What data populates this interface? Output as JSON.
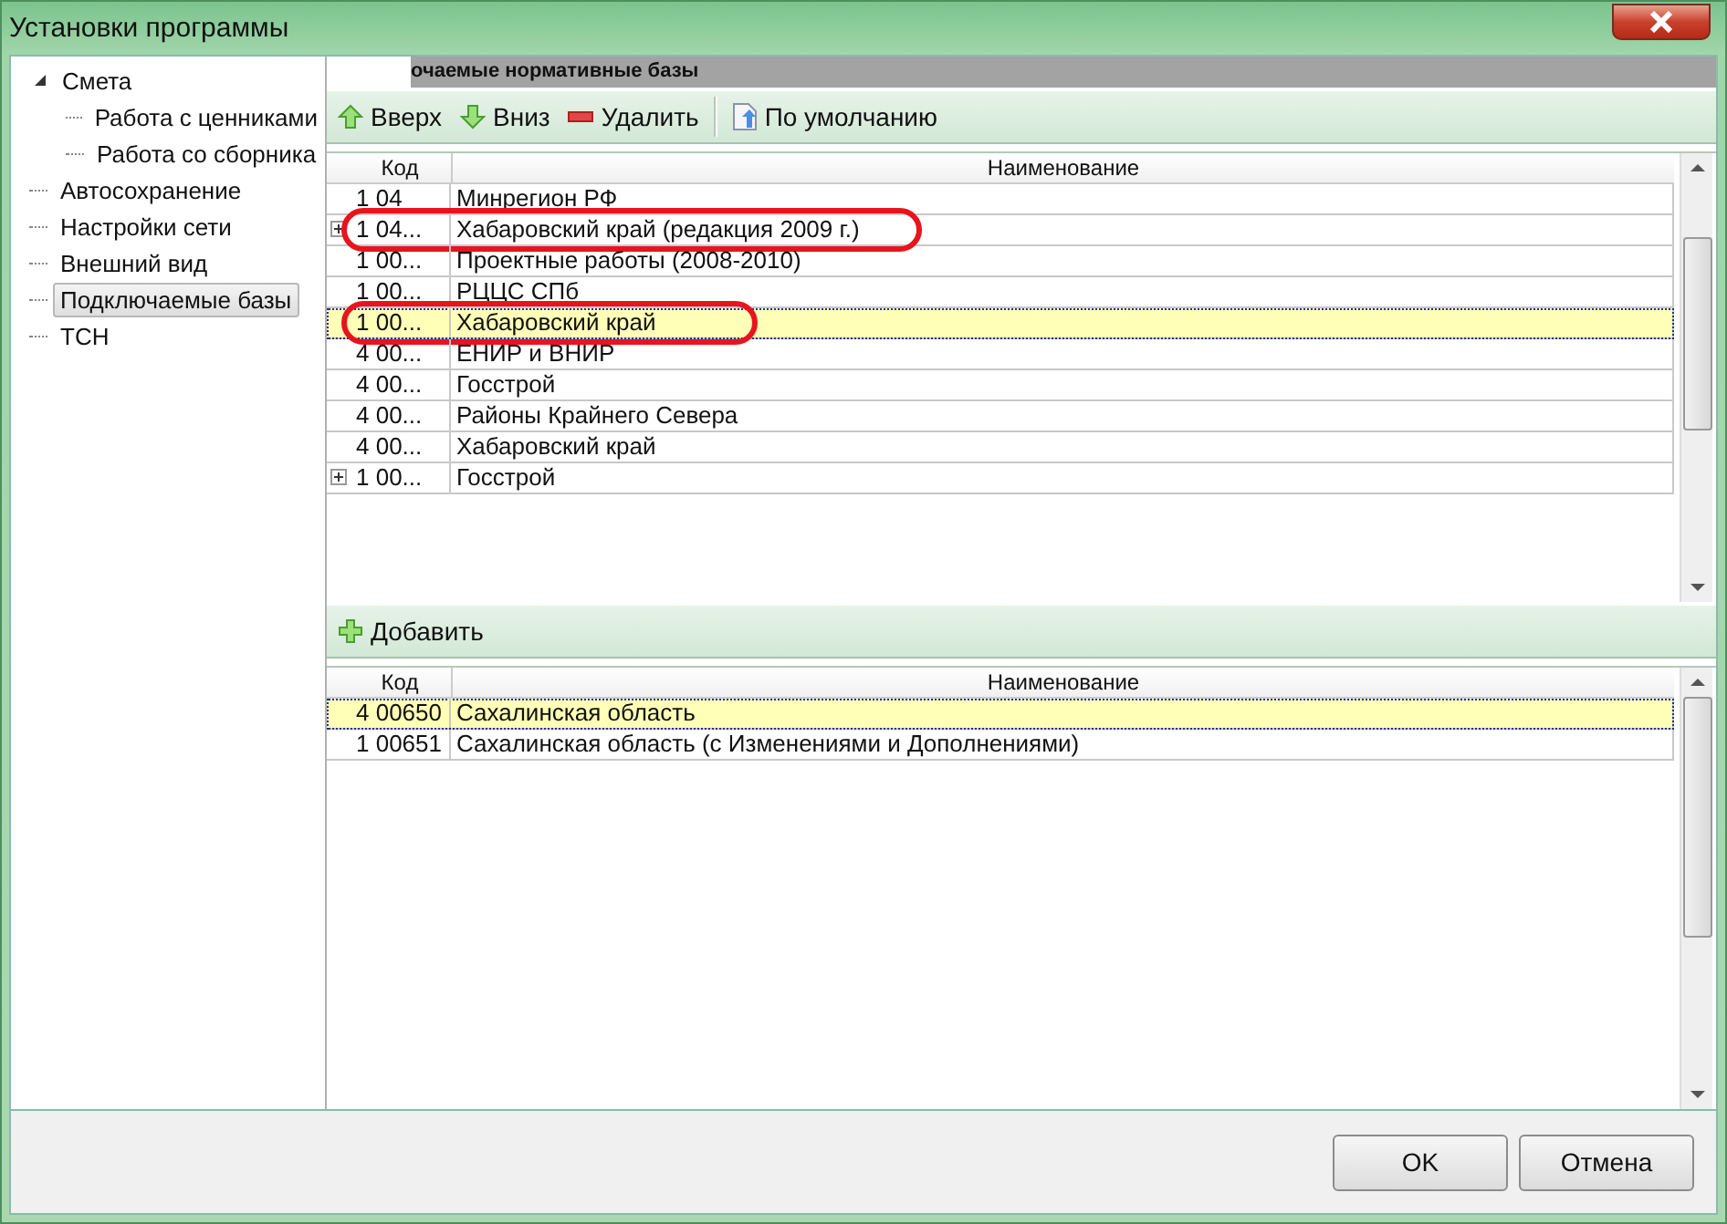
{
  "window": {
    "title": "Установки программы"
  },
  "tree": [
    {
      "label": "Смета",
      "expanded": true,
      "selected": false,
      "children": [
        {
          "label": "Работа с ценниками",
          "selected": false
        },
        {
          "label": "Работа со сборника",
          "selected": false
        }
      ]
    },
    {
      "label": "Автосохранение",
      "selected": false
    },
    {
      "label": "Настройки сети",
      "selected": false
    },
    {
      "label": "Внешний вид",
      "selected": false
    },
    {
      "label": "Подключаемые базы",
      "selected": true
    },
    {
      "label": "ТСН",
      "selected": false
    }
  ],
  "panel_title": "очаемые нормативные базы",
  "toolbar": [
    {
      "label": "Вверх",
      "kind": "up"
    },
    {
      "label": "Вниз",
      "kind": "down"
    },
    {
      "label": "Удалить",
      "kind": "delete"
    },
    {
      "label": "По умолчанию",
      "kind": "default"
    }
  ],
  "bases_table": {
    "columns": [
      "Код",
      "Наименование"
    ],
    "rows": [
      {
        "code": "1 04",
        "name": "Минрегион РФ",
        "expandable": false,
        "selected": false,
        "circled": false
      },
      {
        "code": "1 04...",
        "name": "Хабаровский край (редакция 2009 г.)",
        "expandable": true,
        "selected": false,
        "circled": true
      },
      {
        "code": "1 00...",
        "name": "Проектные работы (2008-2010)",
        "expandable": false,
        "selected": false,
        "circled": false
      },
      {
        "code": "1 00...",
        "name": "РЦЦС СПб",
        "expandable": false,
        "selected": false,
        "circled": false
      },
      {
        "code": "1 00...",
        "name": "Хабаровский край",
        "expandable": false,
        "selected": true,
        "circled": true
      },
      {
        "code": "4 00...",
        "name": "ЕНИР и ВНИР",
        "expandable": false,
        "selected": false,
        "circled": false
      },
      {
        "code": "4 00...",
        "name": "Госстрой",
        "expandable": false,
        "selected": false,
        "circled": false
      },
      {
        "code": "4 00...",
        "name": "Районы Крайнего Севера",
        "expandable": false,
        "selected": false,
        "circled": false
      },
      {
        "code": "4 00...",
        "name": "Хабаровский край",
        "expandable": false,
        "selected": false,
        "circled": false
      },
      {
        "code": "1 00...",
        "name": "Госстрой",
        "expandable": true,
        "selected": false,
        "circled": false
      }
    ]
  },
  "add_toolbar": [
    {
      "label": "Добавить",
      "kind": "add"
    }
  ],
  "chosen_table": {
    "columns": [
      "Код",
      "Наименование"
    ],
    "rows": [
      {
        "code": "4 00650",
        "name": "Сахалинская область",
        "expandable": false,
        "selected": true,
        "circled": false
      },
      {
        "code": "1 00651",
        "name": "Сахалинская область (с Изменениями и Дополнениями)",
        "expandable": false,
        "selected": false,
        "circled": false
      }
    ]
  },
  "buttons": [
    "OK",
    "Отмена"
  ]
}
